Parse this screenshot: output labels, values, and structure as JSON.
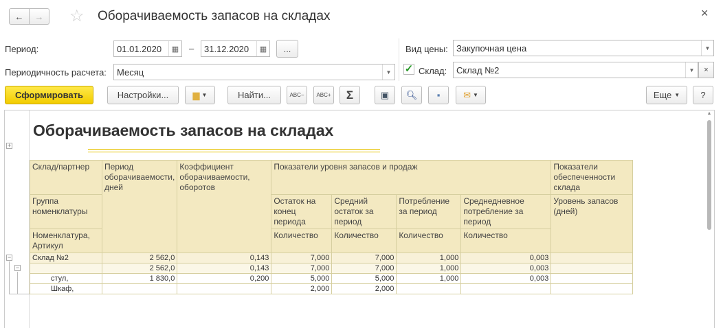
{
  "window": {
    "title": "Оборачиваемость запасов на складах",
    "close": "×",
    "back": "←",
    "forward": "→",
    "star": "☆"
  },
  "filters": {
    "period_label": "Период:",
    "date_from": "01.01.2020",
    "dash": "–",
    "date_to": "31.12.2020",
    "more": "...",
    "periodicity_label": "Периодичность расчета:",
    "periodicity_value": "Месяц",
    "price_type_label": "Вид цены:",
    "price_type_value": "Закупочная цена",
    "warehouse_label": "Склад:",
    "warehouse_checked": true,
    "warehouse_value": "Склад №2"
  },
  "toolbar": {
    "generate": "Сформировать",
    "settings": "Настройки...",
    "find": "Найти...",
    "sum": "Σ",
    "more": "Еще",
    "help": "?"
  },
  "report": {
    "title": "Оборачиваемость запасов на складах",
    "headers": {
      "c1r1": "Склад/партнер",
      "c1r2": "Группа номенклатуры",
      "c1r3": "Номенклатура, Артикул",
      "c2": "Период оборачиваемости, дней",
      "c3": "Коэффициент оборачиваемости, оборотов",
      "group1": "Показатели уровня запасов и продаж",
      "c4": "Остаток на конец периода",
      "c5": "Средний остаток за период",
      "c6": "Потребление за период",
      "c7": "Среднедневное потребление за период",
      "qty": "Количество",
      "group2": "Показатели обеспеченности склада",
      "c8": "Уровень запасов (дней)"
    },
    "rows": [
      {
        "name": "Склад №2",
        "period": "2 562,0",
        "coef": "0,143",
        "end": "7,000",
        "avg": "7,000",
        "cons": "1,000",
        "daily": "0,003",
        "level": ""
      },
      {
        "name": "",
        "period": "2 562,0",
        "coef": "0,143",
        "end": "7,000",
        "avg": "7,000",
        "cons": "1,000",
        "daily": "0,003",
        "level": ""
      },
      {
        "name": "стул,",
        "period": "1 830,0",
        "coef": "0,200",
        "end": "5,000",
        "avg": "5,000",
        "cons": "1,000",
        "daily": "0,003",
        "level": ""
      },
      {
        "name": "Шкаф,",
        "period": "",
        "coef": "",
        "end": "2,000",
        "avg": "2,000",
        "cons": "",
        "daily": "",
        "level": ""
      }
    ]
  }
}
